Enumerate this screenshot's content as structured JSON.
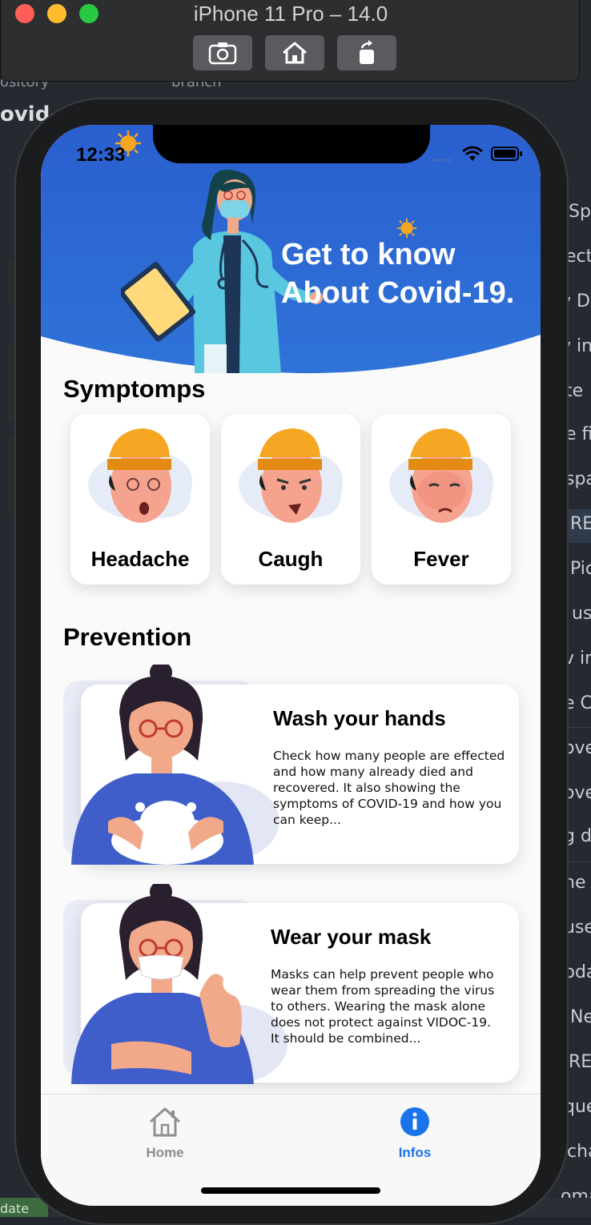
{
  "simulator": {
    "title": "iPhone 11 Pro – 14.0",
    "buttons": [
      "screenshot-icon",
      "home-icon",
      "rotate-icon"
    ]
  },
  "background_editor": {
    "top_left": [
      "ository",
      "ovid-"
    ],
    "top_mid": "branch",
    "right_fragments": [
      "Sp",
      "ect",
      "v D",
      "v in",
      "te",
      "e fi",
      "spa",
      "RE",
      "Pic",
      "us",
      "v in",
      "e Ca",
      "ove",
      "ove",
      "g da",
      "ne",
      "use",
      "pda",
      "Ne",
      "RE",
      "que",
      "cha",
      "oma"
    ],
    "bottom_left": "date"
  },
  "status_bar": {
    "time": "12:33"
  },
  "header": {
    "line1": "Get to know",
    "line2": "About Covid-19."
  },
  "symptoms": {
    "title": "Symptomps",
    "items": [
      {
        "label": "Headache"
      },
      {
        "label": "Caugh"
      },
      {
        "label": "Fever"
      }
    ]
  },
  "prevention": {
    "title": "Prevention",
    "items": [
      {
        "title": "Wash your hands",
        "text": "Check how many people are effected and how many already died and recovered. It also showing the symptoms of COVID-19 and how you can keep..."
      },
      {
        "title": "Wear your mask",
        "text": "Masks can help prevent people who wear them from spreading the virus to others. Wearing the mask alone does not protect against VIDOC-19. It should be combined..."
      }
    ]
  },
  "tabbar": {
    "home_label": "Home",
    "infos_label": "Infos",
    "active": "Infos"
  },
  "colors": {
    "header_blue": "#1f4fc1",
    "header_blue_light": "#3a7cdc",
    "accent_blue": "#1a73e8",
    "tab_inactive": "#8e8e93"
  }
}
